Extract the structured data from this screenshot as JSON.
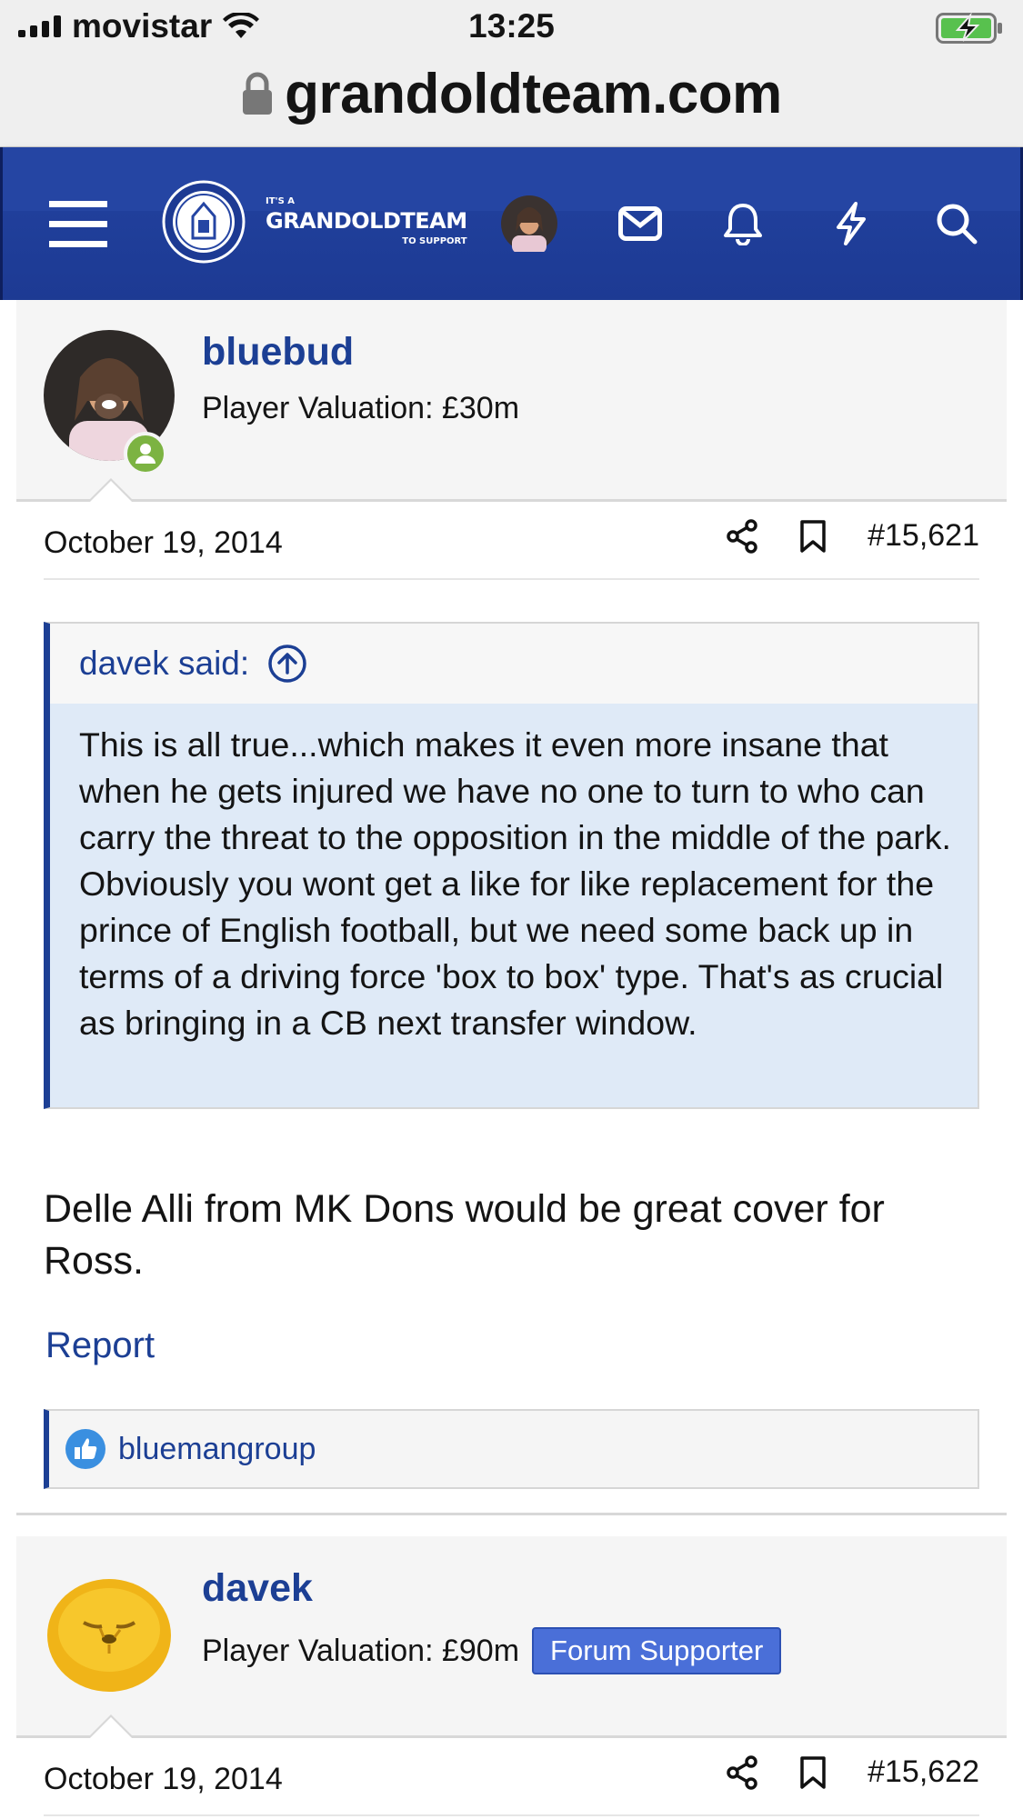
{
  "status_bar": {
    "carrier": "movistar",
    "time": "13:25"
  },
  "browser": {
    "url": "grandoldteam.com"
  },
  "site_header": {
    "logo_line1": "IT'S A",
    "logo_line2": "GRANDOLDTEAM",
    "logo_line3": "TO SUPPORT",
    "icons": [
      "menu-icon",
      "avatar",
      "mail-icon",
      "bell-icon",
      "lightning-icon",
      "search-icon"
    ]
  },
  "posts": [
    {
      "username": "bluebud",
      "valuation": "Player Valuation: £30m",
      "date": "October 19, 2014",
      "post_number": "#15,621",
      "quote": {
        "author": "davek said:",
        "text": "This is all true...which makes it even more insane that when he gets injured we have no one to turn to who can carry the threat to the opposition in the middle of the park. Obviously you wont get a like for like replacement for the prince of English football, but we need some back up in terms of a driving force 'box to box' type. That's as crucial as bringing in a CB next transfer window."
      },
      "body": "Delle Alli from MK Dons would be great cover for Ross.",
      "report_label": "Report",
      "reactions": "bluemangroup"
    },
    {
      "username": "davek",
      "valuation": "Player Valuation: £90m",
      "badge": "Forum Supporter",
      "date": "October 19, 2014",
      "post_number": "#15,622"
    }
  ],
  "colors": {
    "header_blue": "#2545a3",
    "link_blue": "#1c3f94",
    "quote_bg": "#dfeaf7",
    "online_green": "#7cb342",
    "badge_blue": "#4a6fd8"
  }
}
